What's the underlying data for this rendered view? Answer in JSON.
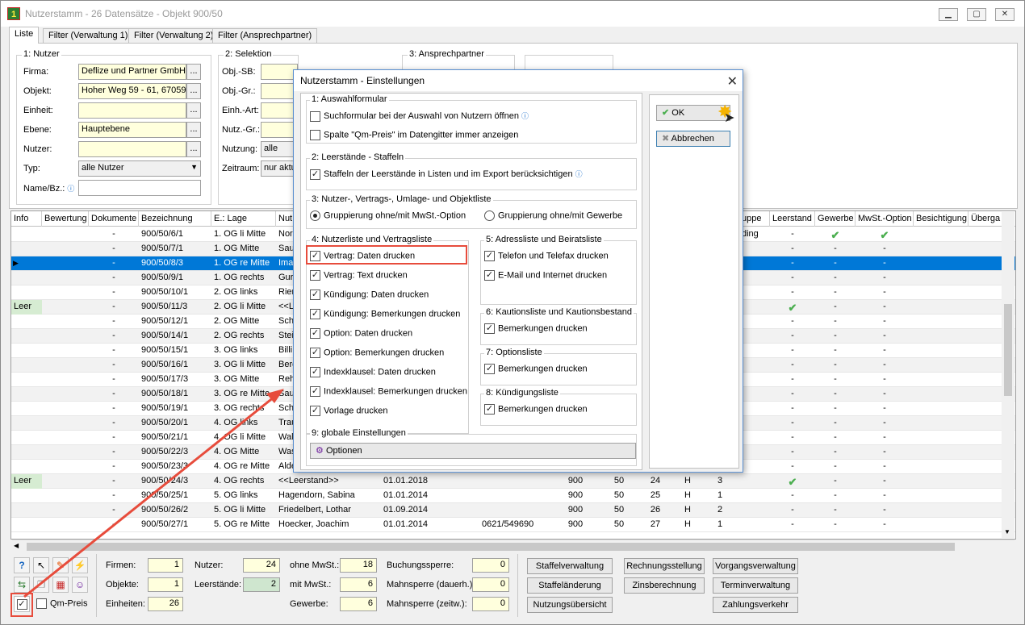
{
  "window": {
    "title": "Nutzerstamm - 26 Datensätze - Objekt 900/50",
    "app_icon": "app-icon"
  },
  "tabs": [
    "Liste",
    "Filter (Verwaltung 1)",
    "Filter (Verwaltung 2)",
    "Filter (Ansprechpartner)"
  ],
  "nutzer_group": {
    "title": "1: Nutzer",
    "labels": {
      "firma": "Firma:",
      "objekt": "Objekt:",
      "einheit": "Einheit:",
      "ebene": "Ebene:",
      "nutzer": "Nutzer:",
      "typ": "Typ:",
      "name": "Name/Bz.:"
    },
    "values": {
      "firma": "Deflize und Partner GmbH",
      "objekt": "Hoher Weg 59 - 61, 67059",
      "einheit": "",
      "ebene": "Hauptebene",
      "nutzer": "",
      "typ": "alle Nutzer",
      "name": ""
    }
  },
  "selektion_group": {
    "title": "2: Selektion",
    "labels": {
      "sb": "Obj.-SB:",
      "gr": "Obj.-Gr.:",
      "art": "Einh.-Art:",
      "ngr": "Nutz.-Gr.:",
      "nutzung": "Nutzung:",
      "zeitraum": "Zeitraum:"
    },
    "values": {
      "nutzung": "alle",
      "zeitraum": "nur aktu"
    }
  },
  "ansprech_group": {
    "title": "3: Ansprechpartner"
  },
  "grid": {
    "columns": [
      "Info",
      "Bewertung",
      "Dokumente",
      "Bezeichnung",
      "E.: Lage",
      "Nut",
      "uppe",
      "Leerstand",
      "Gewerbe",
      "MwSt.-Option",
      "Besichtigung",
      "Überga"
    ],
    "rows": [
      {
        "info": "",
        "dok": "-",
        "bez": "900/50/6/1",
        "lage": "1. OG li Mitte",
        "nut": "Nor",
        "gruppe": "ding",
        "leer": "-",
        "gew": "check",
        "mwst": "check"
      },
      {
        "info": "",
        "dok": "-",
        "bez": "900/50/7/1",
        "lage": "1. OG Mitte",
        "nut": "Sau",
        "gruppe": "",
        "leer": "-",
        "gew": "-",
        "mwst": "-"
      },
      {
        "info": "",
        "dok": "-",
        "bez": "900/50/8/3",
        "lage": "1. OG re Mitte",
        "nut": "Ima",
        "gruppe": "",
        "leer": "-",
        "gew": "-",
        "mwst": "-"
      },
      {
        "info": "",
        "dok": "-",
        "bez": "900/50/9/1",
        "lage": "1. OG rechts",
        "nut": "Gur",
        "gruppe": "",
        "leer": "-",
        "gew": "-",
        "mwst": "-"
      },
      {
        "info": "",
        "dok": "-",
        "bez": "900/50/10/1",
        "lage": "2. OG links",
        "nut": "Rier",
        "gruppe": "",
        "leer": "-",
        "gew": "-",
        "mwst": "-"
      },
      {
        "info": "Leer",
        "dok": "-",
        "bez": "900/50/11/3",
        "lage": "2. OG li Mitte",
        "nut": "<<L",
        "gruppe": "",
        "leer": "check",
        "gew": "-",
        "mwst": "-"
      },
      {
        "info": "",
        "dok": "-",
        "bez": "900/50/12/1",
        "lage": "2. OG Mitte",
        "nut": "Sch",
        "gruppe": "",
        "leer": "-",
        "gew": "-",
        "mwst": "-"
      },
      {
        "info": "",
        "dok": "-",
        "bez": "900/50/14/1",
        "lage": "2. OG rechts",
        "nut": "Stei",
        "gruppe": "",
        "leer": "-",
        "gew": "-",
        "mwst": "-"
      },
      {
        "info": "",
        "dok": "-",
        "bez": "900/50/15/1",
        "lage": "3. OG links",
        "nut": "Billi",
        "gruppe": "",
        "leer": "-",
        "gew": "-",
        "mwst": "-"
      },
      {
        "info": "",
        "dok": "-",
        "bez": "900/50/16/1",
        "lage": "3. OG li Mitte",
        "nut": "Berg",
        "gruppe": "",
        "leer": "-",
        "gew": "-",
        "mwst": "-"
      },
      {
        "info": "",
        "dok": "-",
        "bez": "900/50/17/3",
        "lage": "3. OG Mitte",
        "nut": "Reh",
        "gruppe": "",
        "leer": "-",
        "gew": "-",
        "mwst": "-"
      },
      {
        "info": "",
        "dok": "-",
        "bez": "900/50/18/1",
        "lage": "3. OG re Mitte",
        "nut": "Sau",
        "gruppe": "",
        "leer": "-",
        "gew": "-",
        "mwst": "-"
      },
      {
        "info": "",
        "dok": "-",
        "bez": "900/50/19/1",
        "lage": "3. OG rechts",
        "nut": "Sch",
        "gruppe": "",
        "leer": "-",
        "gew": "-",
        "mwst": "-"
      },
      {
        "info": "",
        "dok": "-",
        "bez": "900/50/20/1",
        "lage": "4. OG links",
        "nut": "Trau",
        "gruppe": "",
        "leer": "-",
        "gew": "-",
        "mwst": "-"
      },
      {
        "info": "",
        "dok": "-",
        "bez": "900/50/21/1",
        "lage": "4. OG li Mitte",
        "nut": "Wal",
        "gruppe": "",
        "leer": "-",
        "gew": "-",
        "mwst": "-"
      },
      {
        "info": "",
        "dok": "-",
        "bez": "900/50/22/3",
        "lage": "4. OG Mitte",
        "nut": "Was",
        "gruppe": "",
        "leer": "-",
        "gew": "-",
        "mwst": "-"
      },
      {
        "info": "",
        "dok": "-",
        "bez": "900/50/23/3",
        "lage": "4. OG re Mitte",
        "nut": "Alde",
        "gruppe": "",
        "leer": "-",
        "gew": "-",
        "mwst": "-"
      },
      {
        "info": "Leer",
        "dok": "-",
        "bez": "900/50/24/3",
        "lage": "4. OG rechts",
        "nut": "<<Leerstand>>",
        "date": "01.01.2018",
        "tel": "",
        "o": "900",
        "e": "50",
        "n": "24",
        "t": "H",
        "g": "3",
        "leer": "check",
        "gew": "-",
        "mwst": "-"
      },
      {
        "info": "",
        "dok": "-",
        "bez": "900/50/25/1",
        "lage": "5. OG links",
        "nut": "Hagendorn, Sabina",
        "date": "01.01.2014",
        "tel": "",
        "o": "900",
        "e": "50",
        "n": "25",
        "t": "H",
        "g": "1",
        "leer": "-",
        "gew": "-",
        "mwst": "-"
      },
      {
        "info": "",
        "dok": "-",
        "bez": "900/50/26/2",
        "lage": "5. OG li Mitte",
        "nut": "Friedelbert, Lothar",
        "date": "01.09.2014",
        "tel": "",
        "o": "900",
        "e": "50",
        "n": "26",
        "t": "H",
        "g": "2",
        "leer": "-",
        "gew": "-",
        "mwst": "-"
      },
      {
        "info": "",
        "dok": "-",
        "bez": "900/50/27/1",
        "lage": "5. OG re Mitte",
        "nut": "Hoecker, Joachim",
        "date": "01.01.2014",
        "tel": "0621/549690",
        "o": "900",
        "e": "50",
        "n": "27",
        "t": "H",
        "g": "1",
        "leer": "-",
        "gew": "-",
        "mwst": "-"
      }
    ]
  },
  "bottom": {
    "qm_label": "Qm-Preis",
    "labels": {
      "firmen": "Firmen:",
      "objekte": "Objekte:",
      "einheiten": "Einheiten:",
      "nutzer": "Nutzer:",
      "leerstaende": "Leerstände:",
      "ohne": "ohne MwSt.:",
      "mit": "mit MwSt.:",
      "gewerbe": "Gewerbe:",
      "buchung": "Buchungssperre:",
      "mahn1": "Mahnsperre (dauerh.):",
      "mahn2": "Mahnsperre (zeitw.):"
    },
    "values": {
      "firmen": "1",
      "objekte": "1",
      "einheiten": "26",
      "nutzer": "24",
      "leerstaende": "2",
      "ohne": "18",
      "mit": "6",
      "gewerbe": "6",
      "buchung": "0",
      "mahn1": "0",
      "mahn2": "0"
    },
    "buttons": [
      "Staffelverwaltung",
      "Rechnungsstellung",
      "Vorgangsverwaltung",
      "Staffeländerung",
      "Zinsberechnung",
      "Terminverwaltung",
      "Nutzungsübersicht",
      "Zahlungsverkehr"
    ]
  },
  "dialog": {
    "title": "Nutzerstamm - Einstellungen",
    "g1": {
      "title": "1: Auswahlformular",
      "opts": [
        "Suchformular bei der Auswahl von Nutzern öffnen",
        "Spalte \"Qm-Preis\" im Datengitter immer anzeigen"
      ]
    },
    "g2": {
      "title": "2: Leerstände - Staffeln",
      "opts": [
        "Staffeln der Leerstände in Listen und im Export berücksichtigen"
      ]
    },
    "g3": {
      "title": "3: Nutzer-, Vertrags-, Umlage- und Objektliste",
      "opts": [
        "Gruppierung ohne/mit MwSt.-Option",
        "Gruppierung ohne/mit Gewerbe"
      ]
    },
    "g4": {
      "title": "4: Nutzerliste und Vertragsliste",
      "opts": [
        "Vertrag: Daten drucken",
        "Vertrag: Text drucken",
        "Kündigung: Daten drucken",
        "Kündigung: Bemerkungen drucken",
        "Option: Daten drucken",
        "Option: Bemerkungen drucken",
        "Indexklausel: Daten drucken",
        "Indexklausel: Bemerkungen drucken",
        "Vorlage drucken"
      ]
    },
    "g5": {
      "title": "5: Adressliste und Beiratsliste",
      "opts": [
        "Telefon und Telefax drucken",
        "E-Mail und Internet drucken"
      ]
    },
    "g6": {
      "title": "6: Kautionsliste und Kautionsbestand",
      "opts": [
        "Bemerkungen drucken"
      ]
    },
    "g7": {
      "title": "7: Optionsliste",
      "opts": [
        "Bemerkungen drucken"
      ]
    },
    "g8": {
      "title": "8: Kündigungsliste",
      "opts": [
        "Bemerkungen drucken"
      ]
    },
    "g9": {
      "title": "9: globale Einstellungen",
      "button": "Optionen"
    },
    "ok": "OK",
    "cancel": "Abbrechen"
  },
  "colors": {
    "selection": "#0078d7",
    "highlight": "#e74c3c",
    "field": "#ffffdd",
    "check": "#4caf50"
  }
}
